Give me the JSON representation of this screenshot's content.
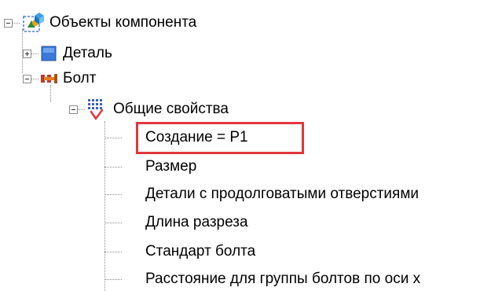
{
  "tree": {
    "root": {
      "label": "Объекты компонента",
      "icon": "component-objects-icon",
      "expanded": true
    },
    "detail": {
      "label": "Деталь",
      "icon": "blue-square-icon",
      "expanded": false
    },
    "bolt": {
      "label": "Болт",
      "icon": "bolt-icon",
      "expanded": true
    },
    "general": {
      "label": "Общие свойства",
      "icon": "grid-check-icon",
      "expanded": true
    },
    "properties": [
      "Создание = P1",
      "Размер",
      "Детали с продолговатыми отверстиями",
      "Длина разреза",
      "Стандарт болта",
      "Расстояние для группы болтов по оси x"
    ],
    "highlighted_index": 0,
    "highlight_color": "#e2363c"
  }
}
